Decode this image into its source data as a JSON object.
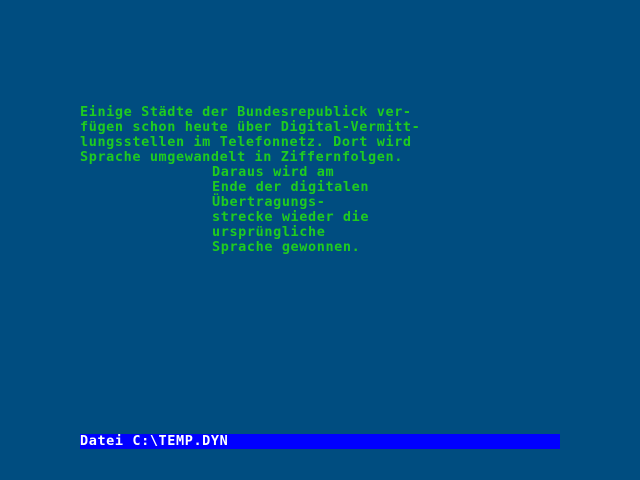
{
  "colors": {
    "background": "#004d80",
    "text": "#1fcc1f",
    "statusbar_background": "#0000ff",
    "statusbar_text": "#ffffff"
  },
  "text": {
    "paragraph_1": "Einige Städte der Bundesrepublick ver-\nfügen schon heute über Digital-Vermitt-\nlungsstellen im Telefonnetz. Dort wird\nSprache umgewandelt in Ziffernfolgen.",
    "paragraph_2": "Daraus wird am\nEnde der digitalen\nÜbertragungs-\nstrecke wieder die\nursprüngliche\nSprache gewonnen."
  },
  "statusbar": {
    "label": "Datei C:\\TEMP.DYN"
  }
}
